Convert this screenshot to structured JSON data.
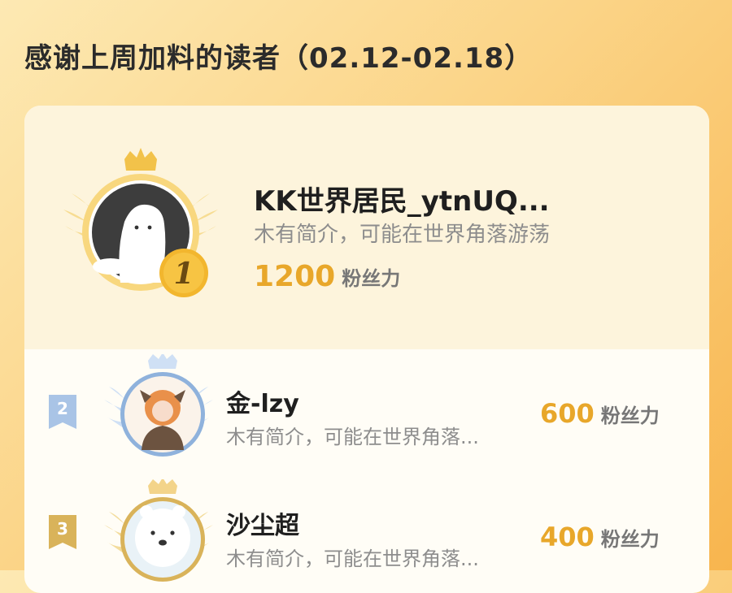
{
  "header": {
    "title": "感谢上周加料的读者（02.12-02.18）"
  },
  "readers": [
    {
      "rank": "1",
      "name": "KK世界居民_ytnUQ...",
      "bio": "木有简介，可能在世界角落游荡",
      "fans": "1200",
      "fans_unit": "粉丝力"
    },
    {
      "rank": "2",
      "name": "金-lzy",
      "bio": "木有简介，可能在世界角落...",
      "fans": "600",
      "fans_unit": "粉丝力"
    },
    {
      "rank": "3",
      "name": "沙尘超",
      "bio": "木有简介，可能在世界角落...",
      "fans": "400",
      "fans_unit": "粉丝力"
    }
  ],
  "colors": {
    "accent": "#e8a72a",
    "gold": "#f2c24a",
    "silver": "#a9c4e6",
    "bronze": "#d9b35a"
  }
}
